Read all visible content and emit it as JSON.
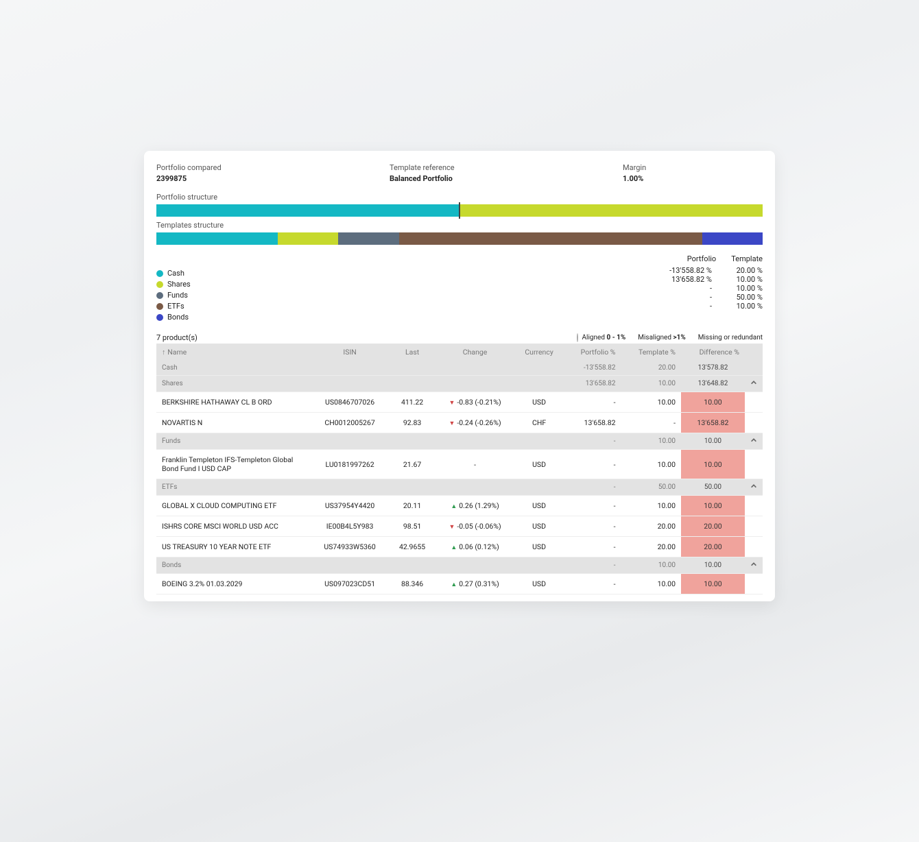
{
  "header": {
    "portfolio_label": "Portfolio compared",
    "portfolio_value": "2399875",
    "template_label": "Template reference",
    "template_value": "Balanced Portfolio",
    "margin_label": "Margin",
    "margin_value": "1.00%"
  },
  "sections": {
    "portfolio_structure": "Portfolio structure",
    "templates_structure": "Templates structure"
  },
  "chart_data": {
    "type": "bar",
    "portfolio_bar": [
      {
        "class": "Cash",
        "pct": 50
      },
      {
        "class": "Shares",
        "pct": 50
      }
    ],
    "template_bar": [
      {
        "class": "Cash",
        "pct": 20
      },
      {
        "class": "Shares",
        "pct": 10
      },
      {
        "class": "Funds",
        "pct": 10
      },
      {
        "class": "ETFs",
        "pct": 50
      },
      {
        "class": "Bonds",
        "pct": 10
      }
    ]
  },
  "legend_headers": {
    "portfolio": "Portfolio",
    "template": "Template"
  },
  "legend": [
    {
      "label": "Cash",
      "color": "cy",
      "portfolio": "-13'558.82 %",
      "template": "20.00 %"
    },
    {
      "label": "Shares",
      "color": "lg",
      "portfolio": "13'658.82 %",
      "template": "10.00 %"
    },
    {
      "label": "Funds",
      "color": "sb",
      "portfolio": "-",
      "template": "10.00 %"
    },
    {
      "label": "ETFs",
      "color": "br",
      "portfolio": "-",
      "template": "50.00 %"
    },
    {
      "label": "Bonds",
      "color": "bl",
      "portfolio": "-",
      "template": "10.00 %"
    }
  ],
  "product_count": "7 product(s)",
  "legend_inline": {
    "aligned_prefix": "Aligned ",
    "aligned_bold": "0 - 1%",
    "misaligned_prefix": "Misaligned ",
    "misaligned_bold": ">1%",
    "missing": "Missing or redundant"
  },
  "columns": {
    "name": "Name",
    "isin": "ISIN",
    "last": "Last",
    "change": "Change",
    "currency": "Currency",
    "portfolio_pct": "Portfolio %",
    "template_pct": "Template %",
    "difference_pct": "Difference %"
  },
  "rows": [
    {
      "type": "cat",
      "name": "Cash",
      "portfolio": "-13'558.82",
      "template": "20.00",
      "diff": "13'578.82",
      "chev": false
    },
    {
      "type": "cat",
      "name": "Shares",
      "portfolio": "13'658.82",
      "template": "10.00",
      "diff": "13'648.82",
      "chev": true
    },
    {
      "type": "row",
      "name": "BERKSHIRE HATHAWAY CL B ORD",
      "isin": "US0846707026",
      "last": "411.22",
      "change": "-0.83 (-0.21%)",
      "dir": "down",
      "currency": "USD",
      "portfolio": "-",
      "template": "10.00",
      "diff": "10.00",
      "hi": true
    },
    {
      "type": "row",
      "name": "NOVARTIS N",
      "isin": "CH0012005267",
      "last": "92.83",
      "change": "-0.24 (-0.26%)",
      "dir": "down",
      "currency": "CHF",
      "portfolio": "13'658.82",
      "template": "-",
      "diff": "13'658.82",
      "hi": true
    },
    {
      "type": "cat",
      "name": "Funds",
      "portfolio": "-",
      "template": "10.00",
      "diff": "10.00",
      "chev": true
    },
    {
      "type": "row",
      "name": "Franklin Templeton IFS-Templeton Global Bond Fund I USD CAP",
      "isin": "LU0181997262",
      "last": "21.67",
      "change": "-",
      "dir": "none",
      "currency": "USD",
      "portfolio": "-",
      "template": "10.00",
      "diff": "10.00",
      "hi": true
    },
    {
      "type": "cat",
      "name": "ETFs",
      "portfolio": "-",
      "template": "50.00",
      "diff": "50.00",
      "chev": true
    },
    {
      "type": "row",
      "name": "GLOBAL X CLOUD COMPUTING ETF",
      "isin": "US37954Y4420",
      "last": "20.11",
      "change": "0.26 (1.29%)",
      "dir": "up",
      "currency": "USD",
      "portfolio": "-",
      "template": "10.00",
      "diff": "10.00",
      "hi": true
    },
    {
      "type": "row",
      "name": "ISHRS CORE MSCI WORLD USD ACC",
      "isin": "IE00B4L5Y983",
      "last": "98.51",
      "change": "-0.05 (-0.06%)",
      "dir": "down",
      "currency": "USD",
      "portfolio": "-",
      "template": "20.00",
      "diff": "20.00",
      "hi": true
    },
    {
      "type": "row",
      "name": "US TREASURY 10 YEAR NOTE ETF",
      "isin": "US74933W5360",
      "last": "42.9655",
      "change": "0.06 (0.12%)",
      "dir": "up",
      "currency": "USD",
      "portfolio": "-",
      "template": "20.00",
      "diff": "20.00",
      "hi": true
    },
    {
      "type": "cat",
      "name": "Bonds",
      "portfolio": "-",
      "template": "10.00",
      "diff": "10.00",
      "chev": true
    },
    {
      "type": "row",
      "name": "BOEING 3.2% 01.03.2029",
      "isin": "US097023CD51",
      "last": "88.346",
      "change": "0.27 (0.31%)",
      "dir": "up",
      "currency": "USD",
      "portfolio": "-",
      "template": "10.00",
      "diff": "10.00",
      "hi": true
    }
  ]
}
